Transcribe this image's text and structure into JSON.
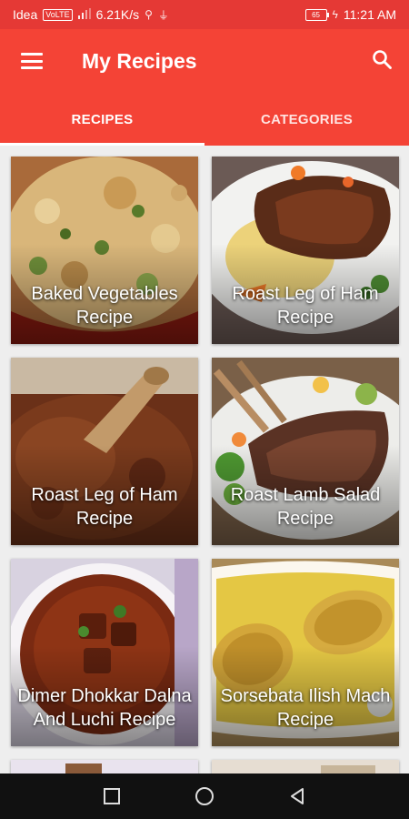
{
  "status_bar": {
    "carrier": "Idea",
    "volte": "VoLTE",
    "speed": "6.21K/s",
    "battery": "65",
    "time": "11:21 AM"
  },
  "app_bar": {
    "title": "My Recipes",
    "menu_icon": "hamburger-menu-icon",
    "search_icon": "search-icon"
  },
  "tabs": [
    {
      "label": "RECIPES",
      "active": true
    },
    {
      "label": "CATEGORIES",
      "active": false
    }
  ],
  "recipes": [
    {
      "name": "Baked Vegetables Recipe"
    },
    {
      "name": "Roast Leg of Ham Recipe"
    },
    {
      "name": "Roast Leg of Ham Recipe"
    },
    {
      "name": "Roast Lamb Salad Recipe"
    },
    {
      "name": "Dimer Dhokkar Dalna And Luchi Recipe"
    },
    {
      "name": "Sorsebata Ilish Mach Recipe"
    }
  ],
  "colors": {
    "status_bar": "#e53935",
    "primary": "#f44336",
    "background": "#eeeeee",
    "nav_bar": "#111111"
  },
  "nav_bar": {
    "recents_icon": "square-recents-icon",
    "home_icon": "circle-home-icon",
    "back_icon": "triangle-back-icon"
  }
}
